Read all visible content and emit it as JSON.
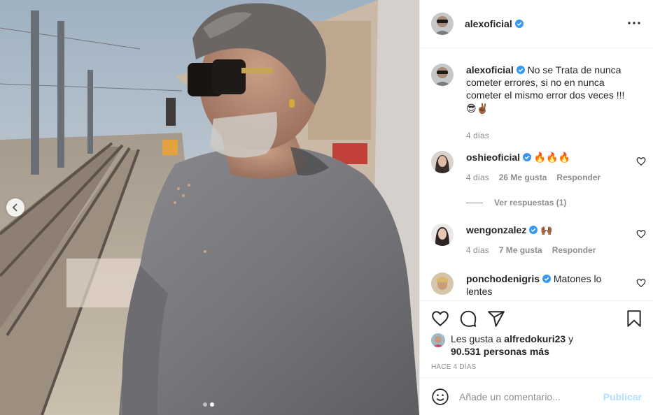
{
  "header": {
    "username": "alexoficial",
    "verified": true,
    "more_icon": "more-options-icon"
  },
  "caption": {
    "username": "alexoficial",
    "text": "No se Trata de nunca cometer errores, si no en nunca cometer el mismo error dos veces !!!",
    "emojis": "😎✌🏾",
    "time": "4 días"
  },
  "comments": [
    {
      "username": "oshieoficial",
      "text": "🔥🔥🔥",
      "time": "4 días",
      "likes": "26 Me gusta",
      "reply": "Responder",
      "view_replies": "Ver respuestas (1)"
    },
    {
      "username": "wengonzalez",
      "text": "🙌🏾",
      "time": "4 días",
      "likes": "7 Me gusta",
      "reply": "Responder"
    },
    {
      "username": "ponchodenigris",
      "text": "Matones lo lentes"
    }
  ],
  "actions": {
    "like_icon": "heart-icon",
    "comment_icon": "comment-icon",
    "share_icon": "paper-plane-icon",
    "save_icon": "bookmark-icon"
  },
  "likes": {
    "prefix": "Les gusta a",
    "user": "alfredokuri23",
    "mid": "y",
    "count": "90.531 personas más"
  },
  "posted_ago": "HACE 4 DÍAS",
  "add_comment": {
    "placeholder": "Añade un comentario...",
    "publish": "Publicar"
  },
  "carousel": {
    "slides": 2,
    "active": 2
  },
  "colors": {
    "accent": "#0095f6",
    "verified": "#3897f0",
    "publish_disabled": "#b2dffc",
    "muted": "#8e8e8e"
  }
}
